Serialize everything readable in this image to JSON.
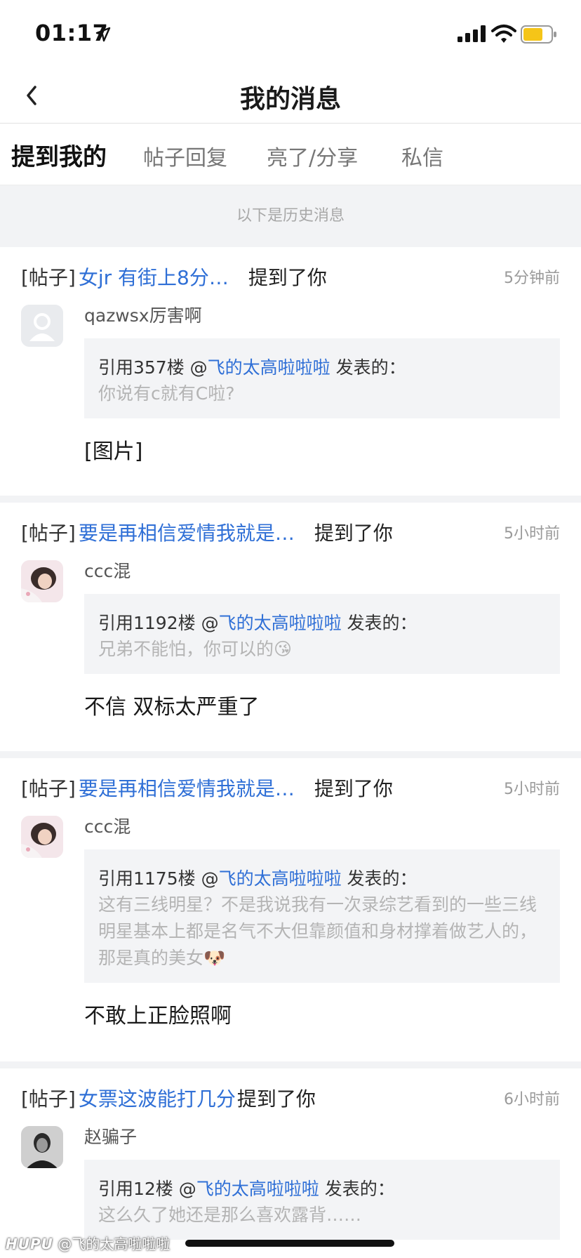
{
  "status_bar": {
    "time": "01:17",
    "battery_color": "#f5c518"
  },
  "nav": {
    "title": "我的消息"
  },
  "tabs": [
    {
      "label": "提到我的",
      "active": true
    },
    {
      "label": "帖子回复",
      "active": false
    },
    {
      "label": "亮了/分享",
      "active": false
    },
    {
      "label": "私信",
      "active": false
    }
  ],
  "history_banner": "以下是历史消息",
  "messages": [
    {
      "tag": "[帖子]",
      "post_title": "女jr 有街上8分…",
      "mentioned": "提到了你",
      "time": "5分钟前",
      "avatar": "default-avatar",
      "username": "qazwsx厉害啊",
      "quote_prefix": "引用357楼 @",
      "quote_user": "飞的太高啦啦啦",
      "quote_suffix": " 发表的：",
      "quote_text": "你说有c就有C啦?",
      "reply": "[图片]"
    },
    {
      "tag": "[帖子]",
      "post_title": "要是再相信爱情我就是…",
      "mentioned": "提到了你",
      "time": "5小时前",
      "avatar": "photo-avatar",
      "username": "ccc混",
      "quote_prefix": "引用1192楼 @",
      "quote_user": "飞的太高啦啦啦",
      "quote_suffix": " 发表的：",
      "quote_text": "兄弟不能怕，你可以的😘",
      "reply": "不信 双标太严重了"
    },
    {
      "tag": "[帖子]",
      "post_title": "要是再相信爱情我就是…",
      "mentioned": "提到了你",
      "time": "5小时前",
      "avatar": "photo-avatar",
      "username": "ccc混",
      "quote_prefix": "引用1175楼 @",
      "quote_user": "飞的太高啦啦啦",
      "quote_suffix": " 发表的：",
      "quote_text": "这有三线明星？不是我说我有一次录综艺看到的一些三线明星基本上都是名气不大但靠颜值和身材撑着做艺人的，那是真的美女🐶",
      "reply": "不敢上正脸照啊"
    },
    {
      "tag": "[帖子]",
      "post_title": "女票这波能打几分",
      "mentioned": "提到了你",
      "time": "6小时前",
      "avatar": "photo-avatar",
      "username": "赵骗子",
      "quote_prefix": "引用12楼 @",
      "quote_user": "飞的太高啦啦啦",
      "quote_suffix": " 发表的：",
      "quote_text": "这么久了她还是那么喜欢露背……",
      "reply": ""
    }
  ],
  "watermark": {
    "brand": "HUPU",
    "handle": "@飞的太高啦啦啦"
  }
}
